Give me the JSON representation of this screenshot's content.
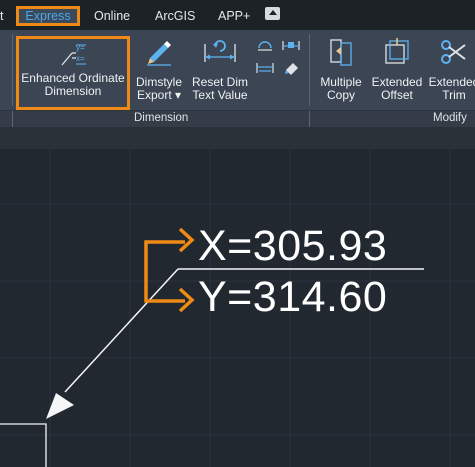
{
  "tabs": {
    "stub": "t",
    "express": "Express",
    "online": "Online",
    "arcgis": "ArcGIS",
    "app": "APP+"
  },
  "ribbon": {
    "enhanced_ordinate": [
      "Enhanced Ordinate",
      "Dimension"
    ],
    "dimstyle_export": [
      "Dimstyle",
      "Export ▾"
    ],
    "reset_dim": [
      "Reset Dim",
      "Text Value"
    ],
    "multiple_copy": [
      "Multiple",
      "Copy"
    ],
    "extended_offset": [
      "Extended",
      "Offset"
    ],
    "extended_trim": [
      "Extended",
      "Trim"
    ],
    "panels": {
      "dimension": "Dimension",
      "modify": "Modify"
    }
  },
  "drawing": {
    "x_label": "X=305.93",
    "y_label": "Y=314.60"
  },
  "colors": {
    "accent": "#f08a17",
    "active_tab_text": "#4fa6e6",
    "ribbon_bg": "#3b4553",
    "canvas_bg": "#212830"
  }
}
